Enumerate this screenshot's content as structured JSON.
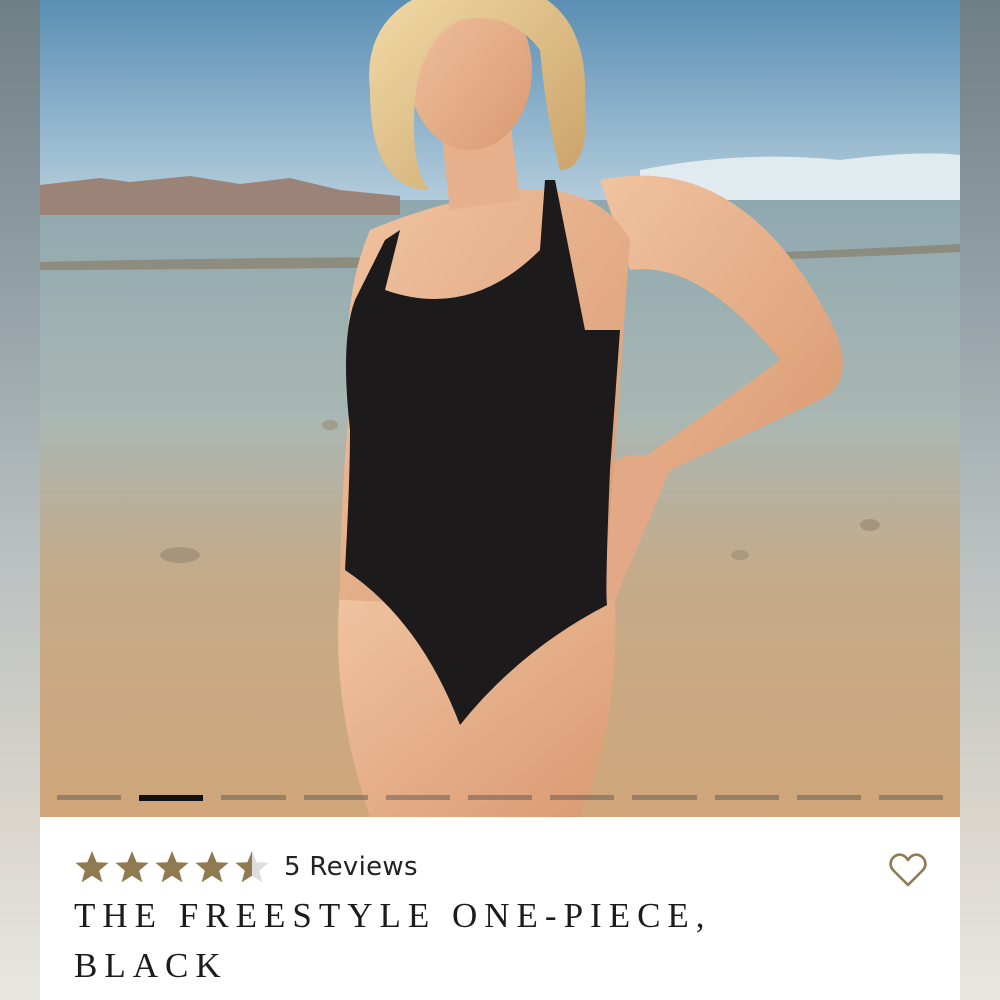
{
  "product": {
    "rating": 4.5,
    "rating_max": 5,
    "reviews_label": "5 Reviews",
    "title": "THE FREESTYLE ONE-PIECE, BLACK"
  },
  "carousel": {
    "slide_count": 11,
    "active_index": 1
  },
  "icons": {
    "wishlist": "heart-outline-icon",
    "star": "star-icon"
  },
  "colors": {
    "star_filled": "#8f7a52",
    "star_empty": "#dddddd",
    "heart": "#8f7a52"
  }
}
